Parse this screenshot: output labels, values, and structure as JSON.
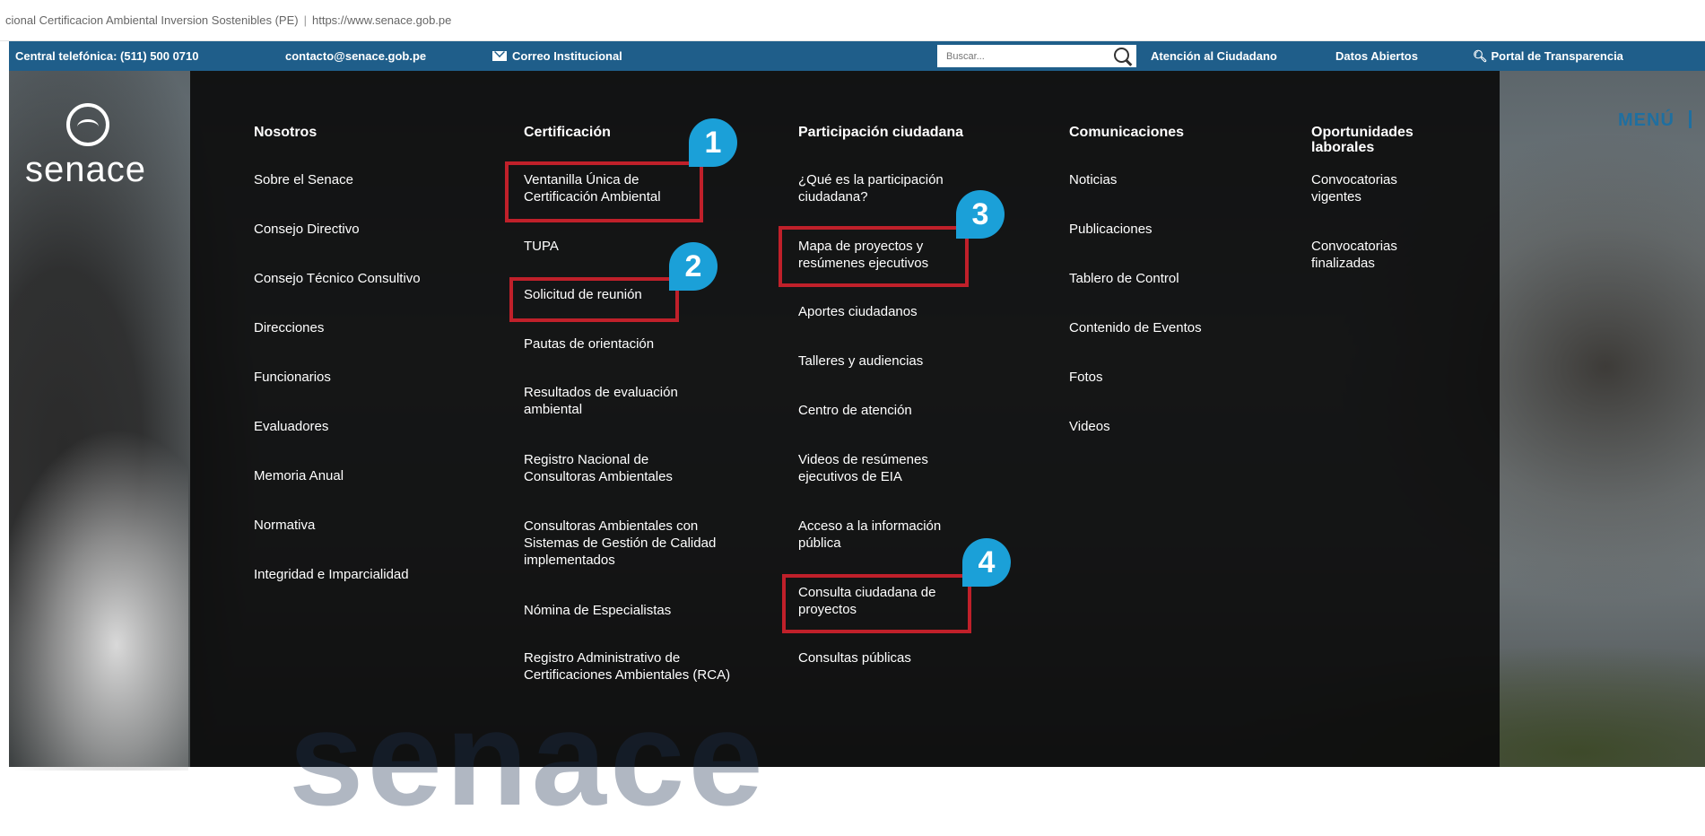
{
  "browser": {
    "title": "cional Certificacion Ambiental Inversion Sostenibles (PE)",
    "url": "https://www.senace.gob.pe"
  },
  "topbar": {
    "phone": "Central telefónica: (511) 500 0710",
    "email": "contacto@senace.gob.pe",
    "mail_label": "Correo Institucional",
    "search_placeholder": "Buscar...",
    "citizen": "Atención al Ciudadano",
    "open_data": "Datos Abiertos",
    "transparency": "Portal de Transparencia"
  },
  "logo": {
    "text": "senace"
  },
  "menu_label": "MENÚ",
  "megamenu": {
    "ghost_text": "senace",
    "columns": [
      {
        "title": "Nosotros",
        "items": [
          "Sobre el Senace",
          "Consejo Directivo",
          "Consejo Técnico Consultivo",
          "Direcciones",
          "Funcionarios",
          "Evaluadores",
          "Memoria Anual",
          "Normativa",
          "Integridad e Imparcialidad"
        ]
      },
      {
        "title": "Certificación",
        "items": [
          "Ventanilla Única de Certificación Ambiental",
          "TUPA",
          "Solicitud de reunión",
          "Pautas de orientación",
          "Resultados de evaluación ambiental",
          "Registro Nacional de Consultoras Ambientales",
          "Consultoras Ambientales con Sistemas de Gestión de Calidad implementados",
          "Nómina de Especialistas",
          "Registro Administrativo de Certificaciones Ambientales (RCA)"
        ]
      },
      {
        "title": "Participación ciudadana",
        "items": [
          "¿Qué es la participación ciudadana?",
          "Mapa de proyectos y resúmenes ejecutivos",
          "Aportes ciudadanos",
          "Talleres y audiencias",
          "Centro de atención",
          "Videos de resúmenes ejecutivos de EIA",
          "Acceso a la información pública",
          "Consulta ciudadana de proyectos",
          "Consultas públicas"
        ]
      },
      {
        "title": "Comunicaciones",
        "items": [
          "Noticias",
          "Publicaciones",
          "Tablero de Control",
          "Contenido de Eventos",
          "Fotos",
          "Videos"
        ]
      },
      {
        "title": "Oportunidades laborales",
        "items": [
          "Convocatorias vigentes",
          "Convocatorias finalizadas"
        ]
      }
    ]
  },
  "badges": [
    "1",
    "2",
    "3",
    "4"
  ],
  "colors": {
    "topbar": "#1f5e8a",
    "highlight": "#c0202a",
    "badge": "#1ba0d8"
  }
}
